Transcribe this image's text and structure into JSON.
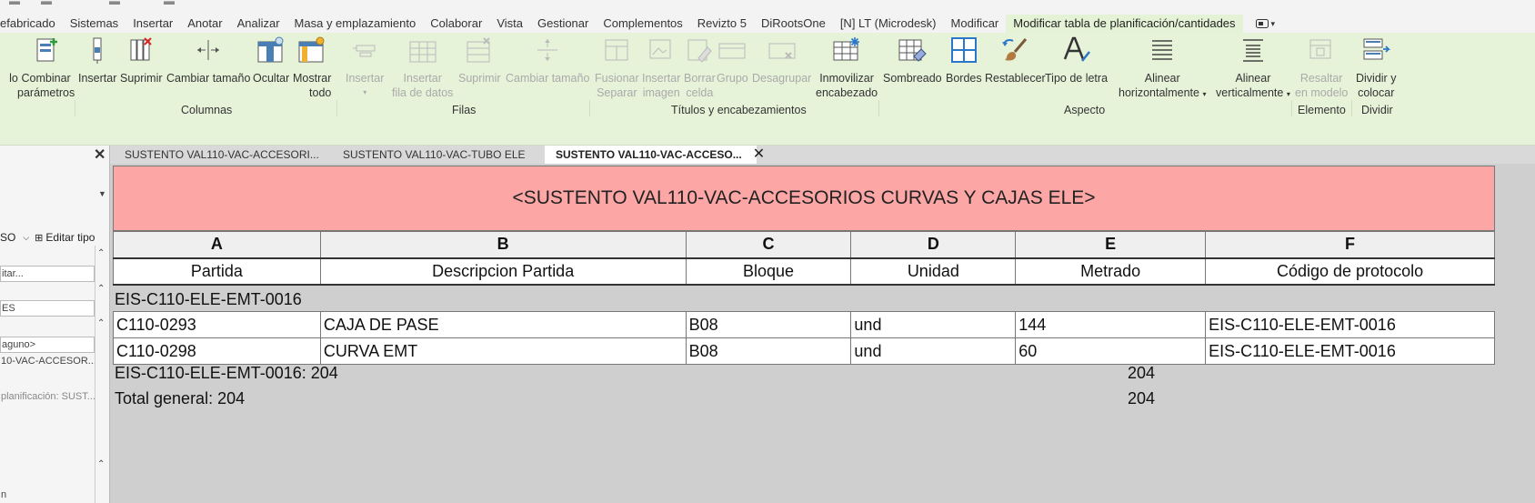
{
  "menu": {
    "items": [
      "efabricado",
      "Sistemas",
      "Insertar",
      "Anotar",
      "Analizar",
      "Masa y emplazamiento",
      "Colaborar",
      "Vista",
      "Gestionar",
      "Complementos",
      "Revizto 5",
      "DiRootsOne",
      "[N] LT (Microdesk)",
      "Modificar",
      "Modificar tabla de planificación/cantidades"
    ],
    "extra_label": "▾"
  },
  "ribbon": {
    "buttons": [
      {
        "line1": "lo",
        "line2": "",
        "disabled": false
      },
      {
        "line1": "Combinar",
        "line2": "parámetros",
        "disabled": false
      },
      {
        "line1": "Insertar",
        "line2": "",
        "disabled": false
      },
      {
        "line1": "Suprimir",
        "line2": "",
        "disabled": false
      },
      {
        "line1": "Cambiar tamaño",
        "line2": "",
        "disabled": false
      },
      {
        "line1": "Ocultar",
        "line2": "",
        "disabled": false
      },
      {
        "line1": "Mostrar",
        "line2": "todo",
        "disabled": false
      },
      {
        "line1": "Insertar",
        "line2": "▾",
        "disabled": true
      },
      {
        "line1": "Insertar",
        "line2": "fila de datos",
        "disabled": true
      },
      {
        "line1": "Suprimir",
        "line2": "",
        "disabled": true
      },
      {
        "line1": "Cambiar tamaño",
        "line2": "",
        "disabled": true
      },
      {
        "line1": "Fusionar",
        "line2": "Separar",
        "disabled": true
      },
      {
        "line1": "Insertar",
        "line2": "imagen",
        "disabled": true
      },
      {
        "line1": "Borrar",
        "line2": "celda",
        "disabled": true
      },
      {
        "line1": "Grupo",
        "line2": "",
        "disabled": true
      },
      {
        "line1": "Desagrupar",
        "line2": "",
        "disabled": true
      },
      {
        "line1": "Inmovilizar",
        "line2": "encabezado",
        "disabled": false
      },
      {
        "line1": "Sombreado",
        "line2": "",
        "disabled": false
      },
      {
        "line1": "Bordes",
        "line2": "",
        "disabled": false
      },
      {
        "line1": "Restablecer",
        "line2": "",
        "disabled": false
      },
      {
        "line1": "Tipo de letra",
        "line2": "",
        "disabled": false
      },
      {
        "line1": "Alinear",
        "line2": "horizontalmente",
        "disabled": false
      },
      {
        "line1": "Alinear",
        "line2": "verticalmente",
        "disabled": false
      },
      {
        "line1": "Resaltar",
        "line2": "en modelo",
        "disabled": true
      },
      {
        "line1": "Dividir y",
        "line2": "colocar",
        "disabled": false
      }
    ],
    "panels": [
      "Columnas",
      "Filas",
      "Títulos y encabezamientos",
      "Aspecto",
      "Elemento",
      "Dividir"
    ]
  },
  "properties_panel": {
    "close": "✕",
    "type_selector_value": "SO",
    "edit_type_label": "Editar tipo",
    "rows": [
      "itar...",
      "ES",
      "aguno>",
      "10-VAC-ACCESOR...",
      "planificación: SUST...",
      "",
      "",
      "",
      "",
      "n"
    ]
  },
  "tabs": [
    {
      "label": "SUSTENTO VAL110-VAC-ACCESORI...",
      "active": false
    },
    {
      "label": "SUSTENTO VAL110-VAC-TUBO ELE",
      "active": false
    },
    {
      "label": "SUSTENTO VAL110-VAC-ACCESO...",
      "active": true
    }
  ],
  "schedule": {
    "title": "<SUSTENTO VAL110-VAC-ACCESORIOS CURVAS Y CAJAS ELE>",
    "column_letters": [
      "A",
      "B",
      "C",
      "D",
      "E",
      "F"
    ],
    "column_headers": [
      "Partida",
      "Descripcion Partida",
      "Bloque",
      "Unidad",
      "Metrado",
      "Código de protocolo"
    ],
    "group_header": "EIS-C110-ELE-EMT-0016",
    "rows": [
      [
        "C110-0293",
        "CAJA DE PASE",
        "B08",
        "und",
        "144",
        "EIS-C110-ELE-EMT-0016"
      ],
      [
        "C110-0298",
        "CURVA EMT",
        "B08",
        "und",
        "60",
        "EIS-C110-ELE-EMT-0016"
      ]
    ],
    "group_footer": {
      "label": "EIS-C110-ELE-EMT-0016: 204",
      "metrado": "204"
    },
    "grand_total": {
      "label": "Total general: 204",
      "metrado": "204"
    }
  }
}
